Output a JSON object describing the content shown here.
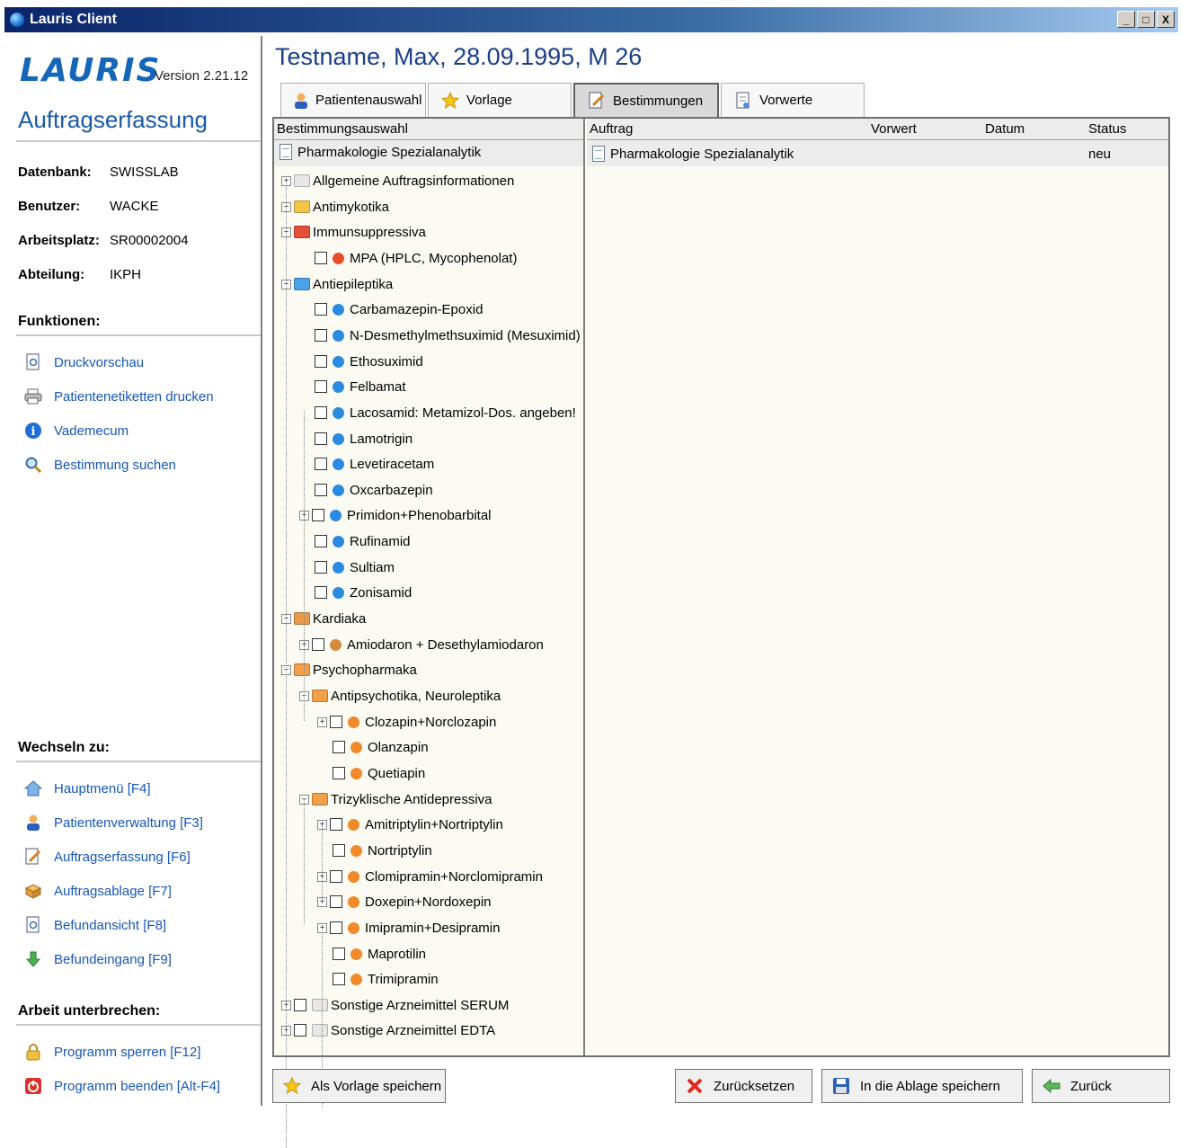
{
  "window": {
    "title": "Lauris Client",
    "buttons": [
      "_",
      "□",
      "X"
    ]
  },
  "sidebar": {
    "logo": "LAURIS",
    "version": "Version 2.21.12",
    "title": "Auftragserfassung",
    "info": [
      {
        "label": "Datenbank:",
        "value": "SWISSLAB"
      },
      {
        "label": "Benutzer:",
        "value": "WACKE"
      },
      {
        "label": "Arbeitsplatz:",
        "value": "SR00002004"
      },
      {
        "label": "Abteilung:",
        "value": "IKPH"
      }
    ],
    "functions_heading": "Funktionen:",
    "functions": [
      {
        "label": "Druckvorschau",
        "icon": "preview-icon"
      },
      {
        "label": "Patientenetiketten drucken",
        "icon": "printer-icon"
      },
      {
        "label": "Vademecum",
        "icon": "info-icon"
      },
      {
        "label": "Bestimmung suchen",
        "icon": "search-icon"
      }
    ],
    "switch_heading": "Wechseln zu:",
    "switch": [
      {
        "label": "Hauptmenü [F4]",
        "icon": "home-icon"
      },
      {
        "label": "Patientenverwaltung [F3]",
        "icon": "person-icon"
      },
      {
        "label": "Auftragserfassung [F6]",
        "icon": "order-edit-icon"
      },
      {
        "label": "Auftragsablage [F7]",
        "icon": "order-storage-icon"
      },
      {
        "label": "Befundansicht [F8]",
        "icon": "report-view-icon"
      },
      {
        "label": "Befundeingang [F9]",
        "icon": "report-inbox-icon"
      }
    ],
    "pause_heading": "Arbeit unterbrechen:",
    "pause": [
      {
        "label": "Programm sperren [F12]",
        "icon": "lock-icon"
      },
      {
        "label": "Programm beenden [Alt-F4]",
        "icon": "power-icon"
      }
    ]
  },
  "main": {
    "patient": "Testname, Max, 28.09.1995, M 26",
    "tabs": [
      {
        "label": "Patientenauswahl",
        "icon": "person-icon"
      },
      {
        "label": "Vorlage",
        "icon": "star-icon"
      },
      {
        "label": "Bestimmungen",
        "icon": "order-edit-icon",
        "active": true
      },
      {
        "label": "Vorwerte",
        "icon": "document-icon"
      }
    ],
    "tree_header": "Bestimmungsauswahl",
    "tree_root": "Pharmakologie Spezialanalytik",
    "tree": [
      {
        "label": "Allgemeine Auftragsinformationen"
      },
      {
        "label": "Antimykotika"
      },
      {
        "label": "Immunsuppressiva"
      },
      {
        "label": "MPA (HPLC, Mycophenolat)"
      },
      {
        "label": "Antiepileptika"
      },
      {
        "label": "Carbamazepin-Epoxid"
      },
      {
        "label": "N-Desmethylmethsuximid (Mesuximid)"
      },
      {
        "label": "Ethosuximid"
      },
      {
        "label": "Felbamat"
      },
      {
        "label": "Lacosamid: Metamizol-Dos. angeben!"
      },
      {
        "label": "Lamotrigin"
      },
      {
        "label": "Levetiracetam"
      },
      {
        "label": "Oxcarbazepin"
      },
      {
        "label": "Primidon+Phenobarbital"
      },
      {
        "label": "Rufinamid"
      },
      {
        "label": "Sultiam"
      },
      {
        "label": "Zonisamid"
      },
      {
        "label": "Kardiaka"
      },
      {
        "label": "Amiodaron + Desethylamiodaron"
      },
      {
        "label": "Psychopharmaka"
      },
      {
        "label": "Antipsychotika, Neuroleptika"
      },
      {
        "label": "Clozapin+Norclozapin"
      },
      {
        "label": "Olanzapin"
      },
      {
        "label": "Quetiapin"
      },
      {
        "label": "Trizyklische Antidepressiva"
      },
      {
        "label": "Amitriptylin+Nortriptylin"
      },
      {
        "label": "Nortriptylin"
      },
      {
        "label": "Clomipramin+Norclomipramin"
      },
      {
        "label": "Doxepin+Nordoxepin"
      },
      {
        "label": "Imipramin+Desipramin"
      },
      {
        "label": "Maprotilin"
      },
      {
        "label": "Trimipramin"
      },
      {
        "label": "Sonstige Arzneimittel SERUM"
      },
      {
        "label": "Sonstige Arzneimittel EDTA"
      }
    ],
    "grid_columns": [
      "Auftrag",
      "Vorwert",
      "Datum",
      "Status"
    ],
    "grid_rows": [
      {
        "auftrag": "Pharmakologie Spezialanalytik",
        "vorwert": "",
        "datum": "",
        "status": "neu"
      }
    ]
  },
  "buttons": {
    "save_template": "Als Vorlage speichern",
    "reset": "Zurücksetzen",
    "save_storage": "In die Ablage speichern",
    "back": "Zurück"
  },
  "colors": {
    "accent": "#1656b8",
    "title_blue": "#1a3f8a",
    "dot_red": "#e8502c",
    "dot_blue": "#2a8be0",
    "dot_brown": "#d58a3e",
    "dot_orange": "#f08a2a"
  }
}
